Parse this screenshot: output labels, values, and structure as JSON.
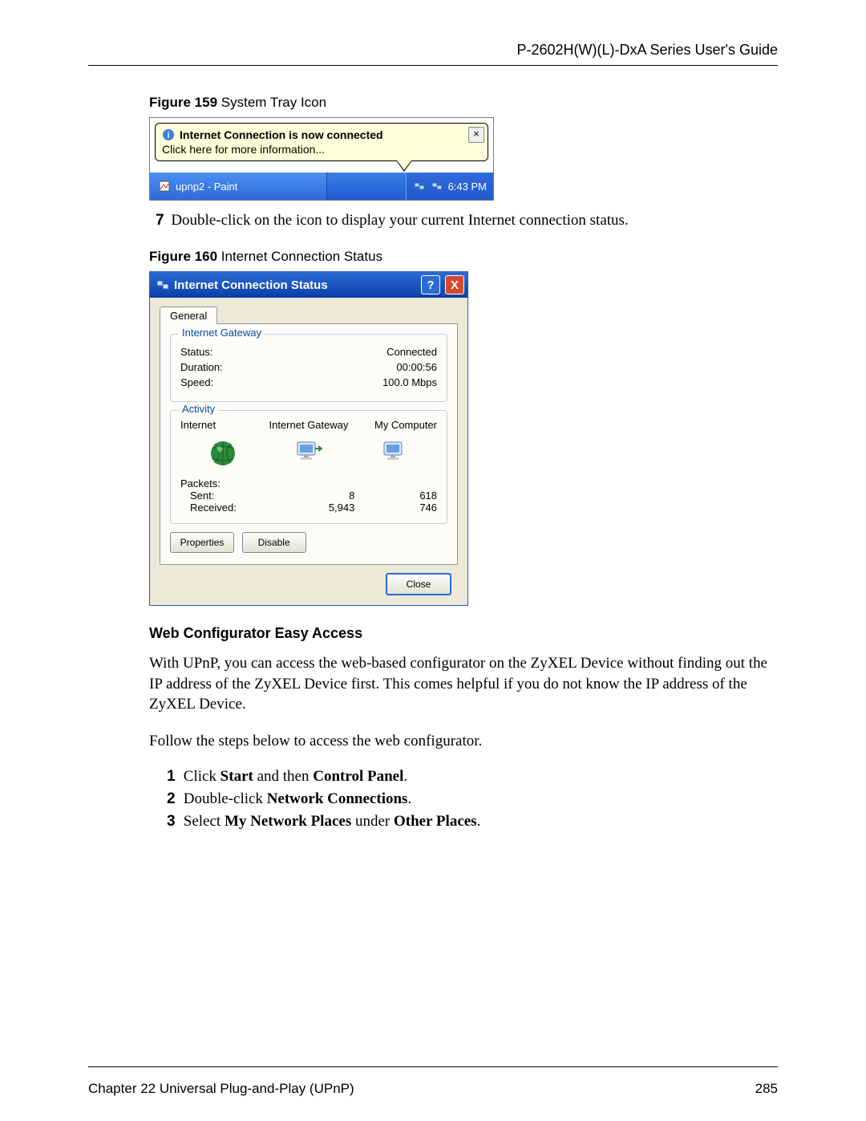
{
  "header": {
    "title": "P-2602H(W)(L)-DxA Series User's Guide"
  },
  "fig159": {
    "label_bold": "Figure 159",
    "label_rest": "   System Tray Icon",
    "tooltip": {
      "title": "Internet Connection is now connected",
      "sub": "Click here for more information...",
      "close": "×"
    },
    "taskbar": {
      "app": "upnp2 - Paint",
      "clock": "6:43 PM"
    }
  },
  "step7": {
    "num": "7",
    "text": "Double-click on the icon to display your current Internet connection status."
  },
  "fig160": {
    "label_bold": "Figure 160",
    "label_rest": "   Internet Connection Status",
    "dialog": {
      "title": "Internet Connection Status",
      "help": "?",
      "close": "X",
      "tab": "General",
      "gateway_legend": "Internet Gateway",
      "status_label": "Status:",
      "status_value": "Connected",
      "duration_label": "Duration:",
      "duration_value": "00:00:56",
      "speed_label": "Speed:",
      "speed_value": "100.0 Mbps",
      "activity_legend": "Activity",
      "col_internet": "Internet",
      "col_gateway": "Internet Gateway",
      "col_mycomputer": "My Computer",
      "packets_label": "Packets:",
      "sent_label": "Sent:",
      "sent_gateway": "8",
      "sent_computer": "618",
      "recv_label": "Received:",
      "recv_gateway": "5,943",
      "recv_computer": "746",
      "btn_properties": "Properties",
      "btn_disable": "Disable",
      "btn_close": "Close"
    }
  },
  "section": {
    "heading": "Web Configurator Easy Access",
    "para1": "With UPnP, you can access the web-based configurator on the ZyXEL Device without finding out the IP address of the ZyXEL Device first. This comes helpful if you do not know the IP address of the ZyXEL Device.",
    "para2": "Follow the steps below to access the web configurator.",
    "steps": {
      "s1_pre": "Click ",
      "s1_b1": "Start",
      "s1_mid": " and then ",
      "s1_b2": "Control Panel",
      "s1_end": ".",
      "s2_pre": "Double-click ",
      "s2_b1": "Network Connections",
      "s2_end": ".",
      "s3_pre": "Select ",
      "s3_b1": "My Network Places",
      "s3_mid": " under ",
      "s3_b2": "Other Places",
      "s3_end": "."
    }
  },
  "footer": {
    "chapter": "Chapter 22 Universal Plug-and-Play (UPnP)",
    "page": "285"
  }
}
